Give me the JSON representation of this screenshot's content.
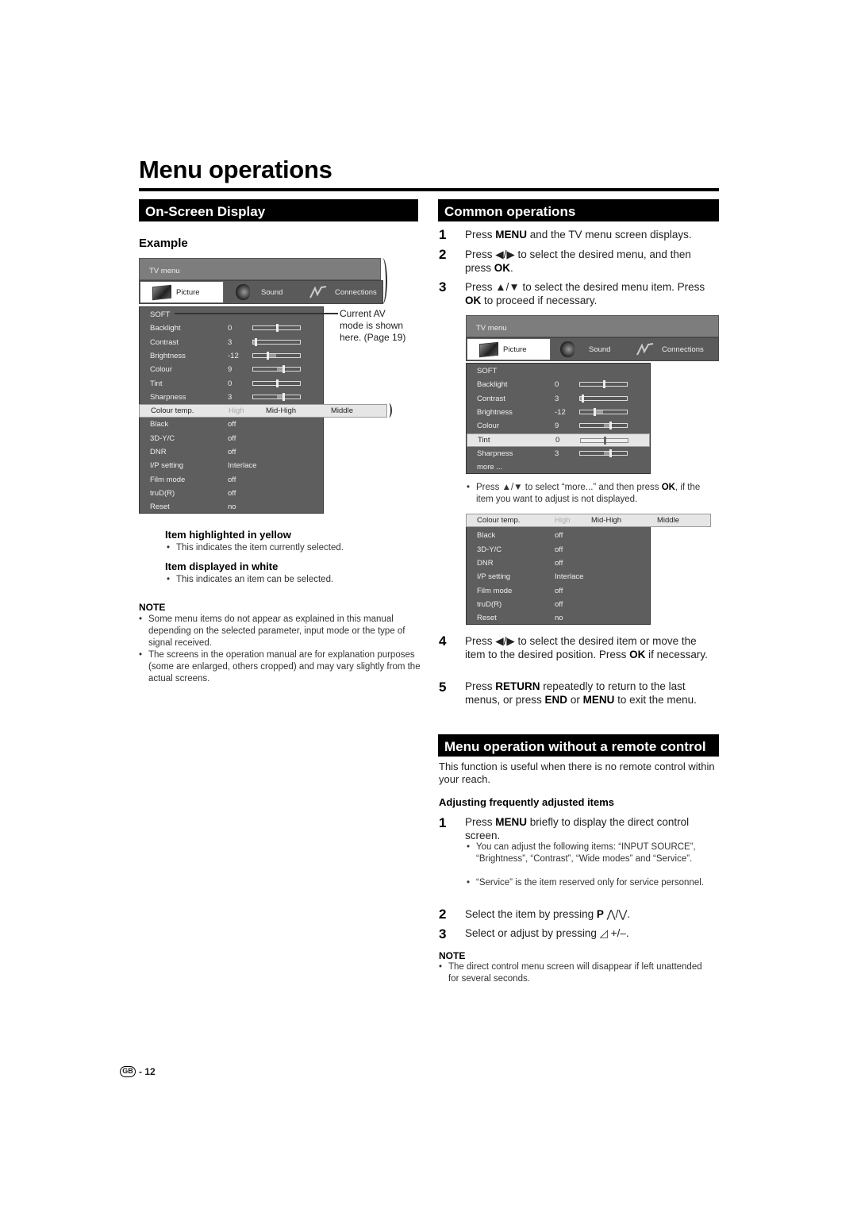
{
  "page": {
    "title": "Menu operations",
    "page_number": "- 12",
    "region_badge": "GB"
  },
  "osd": {
    "section_title": "On-Screen Display",
    "example_label": "Example",
    "tv_menu": {
      "header": "TV menu",
      "tabs": [
        {
          "label": "Picture",
          "icon": "tv-icon",
          "active": true
        },
        {
          "label": "Sound",
          "icon": "speaker-icon",
          "active": false
        },
        {
          "label": "Connections",
          "icon": "connections-icon",
          "active": false
        }
      ],
      "av_mode": "SOFT",
      "slider_items": [
        {
          "name": "Backlight",
          "value": "0",
          "level": 0.5
        },
        {
          "name": "Contrast",
          "value": "3",
          "level": 0.05
        },
        {
          "name": "Brightness",
          "value": "-12",
          "level": 0.3
        },
        {
          "name": "Colour",
          "value": "9",
          "level": 0.65
        },
        {
          "name": "Tint",
          "value": "0",
          "level": 0.5
        },
        {
          "name": "Sharpness",
          "value": "3",
          "level": 0.65
        }
      ],
      "colour_temp": {
        "name": "Colour temp.",
        "options": [
          "High",
          "Mid-High",
          "Middle"
        ]
      },
      "other_items": [
        {
          "name": "Black",
          "value": "off"
        },
        {
          "name": "3D-Y/C",
          "value": "off"
        },
        {
          "name": "DNR",
          "value": "off"
        },
        {
          "name": "I/P setting",
          "value": "Interlace"
        },
        {
          "name": "Film mode",
          "value": "off"
        },
        {
          "name": "truD(R)",
          "value": "off"
        },
        {
          "name": "Reset",
          "value": "no"
        }
      ]
    },
    "callout": [
      "Current AV",
      "mode is shown",
      "here. (Page 19)"
    ],
    "legend": [
      {
        "title": "Item highlighted in yellow",
        "desc": "This indicates the item currently selected."
      },
      {
        "title": "Item displayed in white",
        "desc": "This indicates an item can be selected."
      }
    ],
    "note_label": "NOTE",
    "notes": [
      "Some menu items do not appear as explained in this manual depending on the selected parameter, input mode or the type of signal received.",
      "The screens in the operation manual are for explanation purposes (some are enlarged, others cropped) and may vary slightly from the actual screens."
    ]
  },
  "common": {
    "section_title": "Common operations",
    "steps": [
      {
        "num": "1",
        "html": "Press <b>MENU</b> and the TV menu screen displays."
      },
      {
        "num": "2",
        "html": "Press ◀/▶ to select the desired menu, and then press <b>OK</b>."
      },
      {
        "num": "3",
        "html": "Press ▲/▼ to select the desired menu item. Press <b>OK</b> to proceed if necessary."
      },
      {
        "num": "4",
        "html": "Press ◀/▶ to select the desired item or move the item to the desired position. Press <b>OK</b> if necessary."
      },
      {
        "num": "5",
        "html": "Press <b>RETURN</b> repeatedly to return to the last menus, or press <b>END</b> or <b>MENU</b> to exit the menu."
      }
    ],
    "tv_menu": {
      "header": "TV menu",
      "tabs": [
        {
          "label": "Picture",
          "active": true
        },
        {
          "label": "Sound",
          "active": false
        },
        {
          "label": "Connections",
          "active": false
        }
      ],
      "av_mode": "SOFT",
      "slider_items": [
        {
          "name": "Backlight",
          "value": "0",
          "level": 0.5
        },
        {
          "name": "Contrast",
          "value": "3",
          "level": 0.05
        },
        {
          "name": "Brightness",
          "value": "-12",
          "level": 0.3
        },
        {
          "name": "Colour",
          "value": "9",
          "level": 0.65
        },
        {
          "name": "Tint",
          "value": "0",
          "level": 0.5,
          "selected": true
        },
        {
          "name": "Sharpness",
          "value": "3",
          "level": 0.65
        }
      ],
      "more_label": "more ...",
      "colour_temp": {
        "name": "Colour temp.",
        "options": [
          "High",
          "Mid-High",
          "Middle"
        ]
      },
      "other_items": [
        {
          "name": "Black",
          "value": "off"
        },
        {
          "name": "3D-Y/C",
          "value": "off"
        },
        {
          "name": "DNR",
          "value": "off"
        },
        {
          "name": "I/P setting",
          "value": "Interlace"
        },
        {
          "name": "Film mode",
          "value": "off"
        },
        {
          "name": "truD(R)",
          "value": "off"
        },
        {
          "name": "Reset",
          "value": "no"
        }
      ]
    },
    "more_tip": "Press ▲/▼ to select “more...” and then press <b>OK</b>, if the item you want to adjust is not displayed."
  },
  "no_remote": {
    "section_title": "Menu operation without a remote control",
    "intro": "This function is useful when there is no remote control within your reach.",
    "subhead": "Adjusting frequently adjusted items",
    "step1": {
      "num": "1",
      "html": "Press <b>MENU</b> briefly to display the direct control screen."
    },
    "step1_bullets": [
      "You can adjust the following items: “INPUT SOURCE”, “Brightness”, “Contrast”, “Wide modes” and “Service”.",
      "“Service” is the item reserved only for service personnel."
    ],
    "step2": {
      "num": "2",
      "html": "Select the item by pressing <b>P</b> ⋀/⋁."
    },
    "step3": {
      "num": "3",
      "html": "Select or adjust by pressing ◿ +/–."
    },
    "note_label": "NOTE",
    "note": "The direct control menu screen will disappear if left unattended for several seconds."
  }
}
